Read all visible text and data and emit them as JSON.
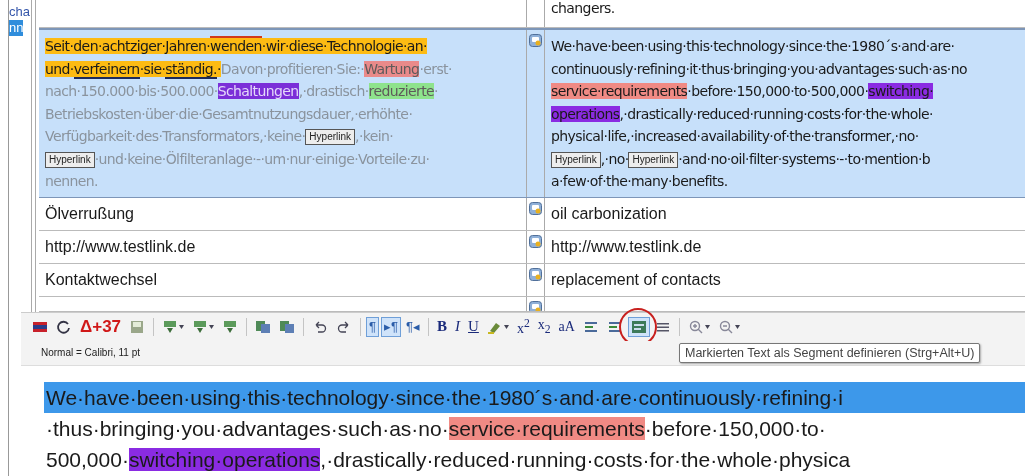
{
  "gutter": [
    {
      "text": "cha",
      "selected": false
    },
    {
      "text": "nn",
      "selected": true
    }
  ],
  "rows": [
    {
      "selected": false,
      "note": false,
      "source": [],
      "target": [
        [
          {
            "kind": "plain",
            "text": "changers."
          }
        ]
      ]
    },
    {
      "selected": true,
      "note": true,
      "source": [
        [
          {
            "kind": "confirmed",
            "text": "Seit·den·achtziger·Jahren·"
          },
          {
            "kind": "confirmed",
            "text": "wenden",
            "bracket_above": true
          },
          {
            "kind": "confirmed",
            "text": "·wir·diese·Technologie·an·"
          }
        ],
        [
          {
            "kind": "confirmed",
            "text": "und·"
          },
          {
            "kind": "confirmed",
            "text": "verfeinern",
            "bracket_below": true
          },
          {
            "kind": "confirmed",
            "text": "·sie·"
          },
          {
            "kind": "confirmed",
            "text": "ständig.",
            "bracket_below": true
          },
          {
            "kind": "confirmed",
            "text": "·"
          },
          {
            "kind": "pending",
            "text": "Davon·profitieren·Sie:·"
          },
          {
            "kind": "fadedmark",
            "text": "Wartung",
            "color": "#e98a8a"
          },
          {
            "kind": "pending",
            "text": "·erst·"
          }
        ],
        [
          {
            "kind": "pending",
            "text": "nach·150.000·bis·500.000·"
          },
          {
            "kind": "fadedmark",
            "text": "Schaltungen",
            "color": "#7b2fd8"
          },
          {
            "kind": "pending",
            "text": ",·drastisch·"
          },
          {
            "kind": "fadedmark",
            "text": "reduzierte",
            "color": "#8ee38c"
          },
          {
            "kind": "pending",
            "text": "·"
          }
        ],
        [
          {
            "kind": "pending",
            "text": "Betriebskosten·über·die·Gesamtnutzungsdauer,·erhöhte·"
          }
        ],
        [
          {
            "kind": "pending",
            "text": "Verfügbarkeit·des·Transformators,·keine·"
          },
          {
            "kind": "tag",
            "text": "Hyperlink"
          },
          {
            "kind": "pending",
            "text": ",·kein·"
          }
        ],
        [
          {
            "kind": "tag",
            "text": "Hyperlink"
          },
          {
            "kind": "pending",
            "text": "·und·keine·Ölfilteranlage·-·um·nur·einige·Vorteile·zu·"
          }
        ],
        [
          {
            "kind": "pending",
            "text": "nennen."
          }
        ]
      ],
      "target": [
        [
          {
            "kind": "plain",
            "text": "We·have·been·using·this·technology·since·the·1980´s·and·are·"
          }
        ],
        [
          {
            "kind": "plain",
            "text": "continuously·refining·it·thus·bringing·you·advantages·such·as·no"
          }
        ],
        [
          {
            "kind": "mark",
            "text": "service·requirements",
            "color": "#f08a84"
          },
          {
            "kind": "plain",
            "text": "·before·150,000·to·500,000·"
          },
          {
            "kind": "mark",
            "text": "switching·",
            "color": "#8a2be2"
          }
        ],
        [
          {
            "kind": "mark",
            "text": "operations",
            "color": "#8a2be2"
          },
          {
            "kind": "plain",
            "text": ",·drastically·reduced·running·costs·for·the·whole·"
          }
        ],
        [
          {
            "kind": "plain",
            "text": "physical·life,·increased·availability·of·the·transformer,·no·"
          }
        ],
        [
          {
            "kind": "tag",
            "text": "Hyperlink"
          },
          {
            "kind": "plain",
            "text": ",·no·"
          },
          {
            "kind": "tag",
            "text": "Hyperlink"
          },
          {
            "kind": "plain",
            "text": "·and·no·oil·filter·systems·-·to·mention·b"
          }
        ],
        [
          {
            "kind": "plain",
            "text": "a·few·of·the·many·benefits."
          }
        ]
      ]
    },
    {
      "selected": false,
      "note": true,
      "source": [
        [
          {
            "kind": "plain",
            "text": "Ölverrußung"
          }
        ]
      ],
      "target": [
        [
          {
            "kind": "plain",
            "text": "oil carbonization"
          }
        ]
      ]
    },
    {
      "selected": false,
      "note": true,
      "source": [
        [
          {
            "kind": "plain",
            "text": "http://www.testlink.de"
          }
        ]
      ],
      "target": [
        [
          {
            "kind": "plain",
            "text": "http://www.testlink.de"
          }
        ]
      ]
    },
    {
      "selected": false,
      "note": true,
      "source": [
        [
          {
            "kind": "plain",
            "text": "Kontaktwechsel"
          }
        ]
      ],
      "target": [
        [
          {
            "kind": "plain",
            "text": "replacement of contacts"
          }
        ]
      ]
    },
    {
      "selected": false,
      "note": true,
      "source": [],
      "target": []
    }
  ],
  "toolbar": {
    "groups": [
      [
        {
          "kind": "flag",
          "pressed": false,
          "dropdown": false
        },
        {
          "kind": "refresh",
          "pressed": false,
          "dropdown": false
        },
        {
          "kind": "counter",
          "label": "Δ+37",
          "pressed": false,
          "dropdown": false
        },
        {
          "kind": "save",
          "pressed": false,
          "dropdown": false
        }
      ],
      [
        {
          "kind": "insert",
          "pressed": false,
          "dropdown": true
        },
        {
          "kind": "insert",
          "pressed": false,
          "dropdown": true
        },
        {
          "kind": "insert",
          "pressed": false,
          "dropdown": false
        }
      ],
      [
        {
          "kind": "copy",
          "pressed": false,
          "dropdown": false
        },
        {
          "kind": "copy",
          "pressed": false,
          "dropdown": false
        }
      ],
      [
        {
          "kind": "undo",
          "pressed": false,
          "dropdown": false
        },
        {
          "kind": "redo",
          "pressed": false,
          "dropdown": false
        }
      ],
      [
        {
          "kind": "mark",
          "label": "¶",
          "pressed": true,
          "dropdown": false
        },
        {
          "kind": "mark",
          "label": "▸¶",
          "pressed": true,
          "dropdown": false
        },
        {
          "kind": "mark",
          "label": "¶◂",
          "pressed": false,
          "dropdown": false
        }
      ],
      [
        {
          "kind": "bold",
          "label": "B",
          "pressed": false,
          "dropdown": false
        },
        {
          "kind": "italic",
          "label": "I",
          "pressed": false,
          "dropdown": false
        },
        {
          "kind": "underline",
          "label": "U",
          "pressed": false,
          "dropdown": false
        },
        {
          "kind": "highlight",
          "pressed": false,
          "dropdown": true
        },
        {
          "kind": "script",
          "label": "x$^{2}$",
          "pressed": false,
          "dropdown": false
        },
        {
          "kind": "script",
          "label": "x$_{2}$",
          "pressed": false,
          "dropdown": false
        },
        {
          "kind": "script",
          "label": "aA",
          "pressed": false,
          "dropdown": false
        },
        {
          "kind": "align",
          "pressed": false,
          "dropdown": false
        },
        {
          "kind": "align",
          "pressed": false,
          "dropdown": false
        },
        {
          "kind": "segment",
          "pressed": true,
          "circled": true,
          "dropdown": false
        },
        {
          "kind": "lines",
          "pressed": false,
          "dropdown": false
        }
      ],
      [
        {
          "kind": "zoomin",
          "pressed": false,
          "dropdown": true
        },
        {
          "kind": "zoomout",
          "pressed": false,
          "dropdown": true
        }
      ]
    ]
  },
  "style_info": "Normal = Calibri, 11 pt",
  "tooltip": "Markierten Text als Segment definieren (Strg+Alt+U)",
  "editor": {
    "lines": [
      {
        "selected": true,
        "runs": [
          {
            "kind": "plain",
            "text": "We·have·been·using·this·technology·since·the·1980´s·and·are·continuously·refining·i"
          }
        ]
      },
      {
        "selected": false,
        "runs": [
          {
            "kind": "plain",
            "text": "·thus·bringing·you·advantages·such·as·no·"
          },
          {
            "kind": "mark",
            "text": "service·requirements",
            "color": "#f08a84"
          },
          {
            "kind": "plain",
            "text": "·before·150,000·to·"
          }
        ]
      },
      {
        "selected": false,
        "runs": [
          {
            "kind": "plain",
            "text": "500,000·"
          },
          {
            "kind": "mark",
            "text": "switching·operations",
            "color": "#8a2be2"
          },
          {
            "kind": "plain",
            "text": ",·drastically·reduced·running·costs·for·the·whole·physica"
          }
        ]
      }
    ]
  }
}
